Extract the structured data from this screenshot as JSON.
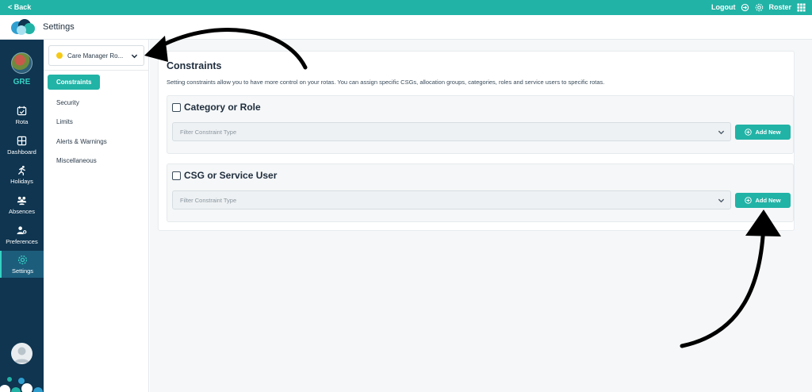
{
  "topbar": {
    "back_label": "< Back",
    "logout_label": "Logout",
    "roster_label": "Roster"
  },
  "header": {
    "title": "Settings"
  },
  "nav": {
    "org_code": "GRE",
    "items": [
      {
        "label": "Rota",
        "icon": "calendar-icon"
      },
      {
        "label": "Dashboard",
        "icon": "grid-icon"
      },
      {
        "label": "Holidays",
        "icon": "person-run-icon"
      },
      {
        "label": "Absences",
        "icon": "people-icon"
      },
      {
        "label": "Preferences",
        "icon": "person-gear-icon"
      },
      {
        "label": "Settings",
        "icon": "gear-icon",
        "active": true
      }
    ]
  },
  "submenu": {
    "dropdown_value": "Care Manager Ro...",
    "links": [
      {
        "label": "Constraints",
        "active": true
      },
      {
        "label": "Security"
      },
      {
        "label": "Limits"
      },
      {
        "label": "Alerts & Warnings"
      },
      {
        "label": "Miscellaneous"
      }
    ]
  },
  "main": {
    "title": "Constraints",
    "description": "Setting constraints allow you to have more control on your rotas. You can assign specific CSGs, allocation groups, categories, roles and service users to specific rotas.",
    "panels": [
      {
        "title": "Category or Role",
        "select_placeholder": "Filter Constraint Type",
        "button_label": "Add New"
      },
      {
        "title": "CSG or Service User",
        "select_placeholder": "Filter Constraint Type",
        "button_label": "Add New"
      }
    ]
  },
  "colors": {
    "accent": "#21b3a6",
    "nav_bg": "#0f3550",
    "main_bg": "#f5f7f8"
  }
}
